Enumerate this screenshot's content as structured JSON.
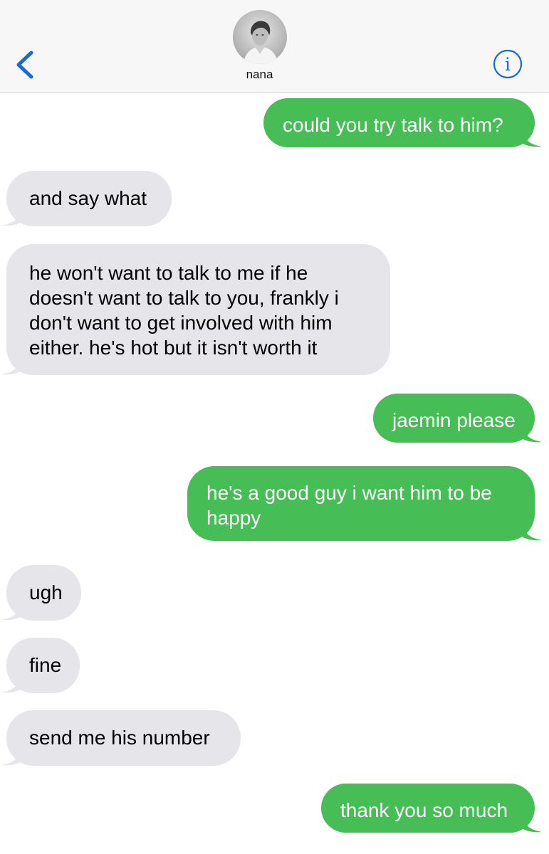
{
  "header": {
    "contact_name": "nana"
  },
  "colors": {
    "outgoing": "#46bd55",
    "incoming": "#e5e5ea",
    "accent": "#1a6bd1"
  },
  "icons": {
    "back": "chevron-left-icon",
    "info": "info-circle-icon",
    "avatar": "contact-photo"
  },
  "messages": [
    {
      "dir": "out",
      "text": "could you try talk to him?"
    },
    {
      "dir": "in",
      "text": "and say what"
    },
    {
      "dir": "in",
      "lines": [
        "he won't want to talk to me if he",
        "doesn't want to talk to you, frankly i",
        "don't want to get involved with him",
        "either. he's hot but it isn't worth it"
      ]
    },
    {
      "dir": "out",
      "text": "jaemin please"
    },
    {
      "dir": "out",
      "lines": [
        "he's a good guy i want him to be",
        "happy"
      ]
    },
    {
      "dir": "in",
      "text": "ugh"
    },
    {
      "dir": "in",
      "text": "fine"
    },
    {
      "dir": "in",
      "text": "send me his number"
    },
    {
      "dir": "out",
      "text": "thank you so much"
    }
  ]
}
